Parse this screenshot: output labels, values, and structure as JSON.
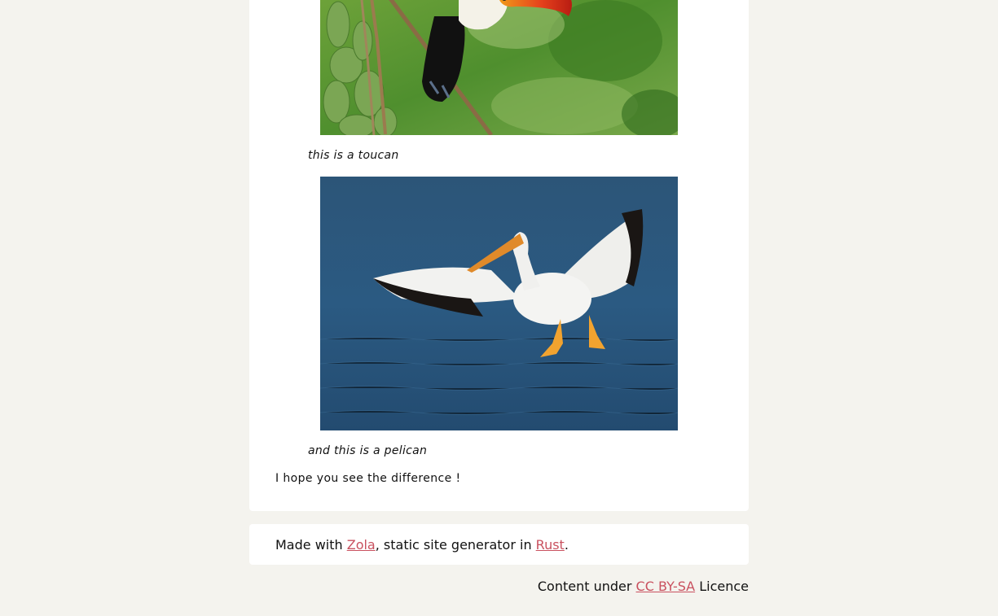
{
  "captions": {
    "toucan": "this is a toucan",
    "pelican": "and this is a pelican"
  },
  "paragraph": "I hope you see the difference !",
  "footer": {
    "made_with_prefix": "Made with ",
    "zola_link": "Zola",
    "middle_text": ", static site generator in ",
    "rust_link": "Rust",
    "suffix": "."
  },
  "licence": {
    "prefix": "Content under ",
    "link": "CC BY-SA",
    "suffix": " Licence"
  },
  "colors": {
    "background": "#f4f3ee",
    "card": "#ffffff",
    "link": "#c9515f"
  }
}
